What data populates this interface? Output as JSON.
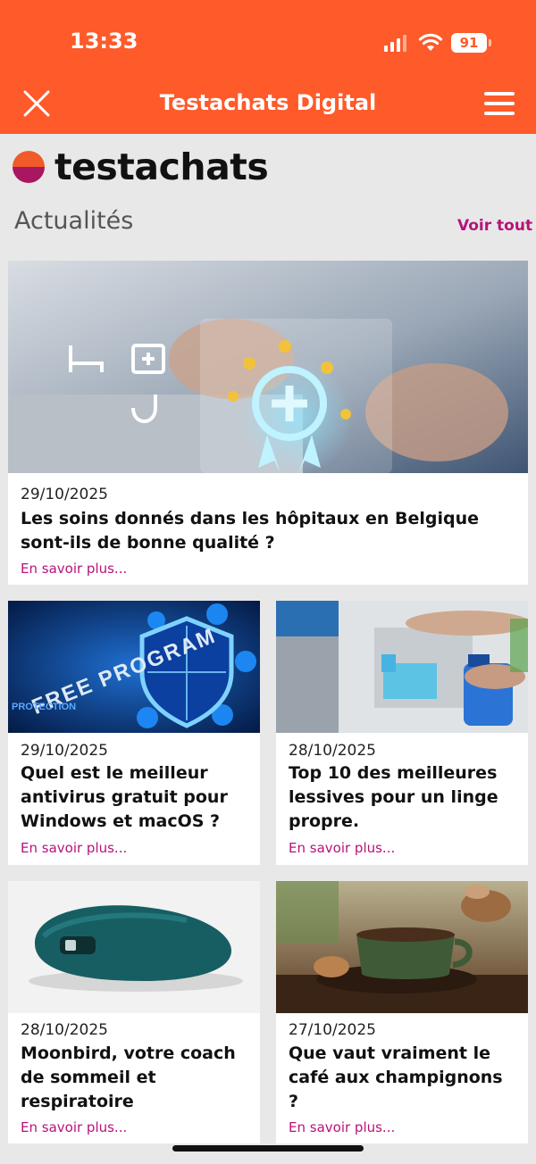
{
  "status_bar": {
    "time": "13:33",
    "battery": "91"
  },
  "nav": {
    "title": "Testachats Digital"
  },
  "brand": {
    "logo_text": "testachats"
  },
  "section": {
    "title": "Actualités",
    "see_all": "Voir tout"
  },
  "articles": [
    {
      "date": "29/10/2025",
      "title": "Les soins donnés dans les hôpitaux en Belgique sont-ils de bonne qualité ?",
      "more": "En savoir plus..."
    },
    {
      "date": "29/10/2025",
      "title": "Quel est le meilleur antivirus gratuit pour Windows et macOS ?",
      "more": "En savoir plus...",
      "image_text": "FREE PROGRAM",
      "image_subtext": "PROTECTION"
    },
    {
      "date": "28/10/2025",
      "title": "Top 10 des meilleures lessives pour un linge propre.",
      "more": "En savoir plus..."
    },
    {
      "date": "28/10/2025",
      "title": "Moonbird, votre coach de sommeil et respiratoire",
      "more": "En savoir plus..."
    },
    {
      "date": "27/10/2025",
      "title": "Que vaut vraiment le café aux champignons ?",
      "more": "En savoir plus..."
    }
  ],
  "colors": {
    "header": "#fe5a2a",
    "accent": "#b8127a",
    "background": "#e8e8e8"
  }
}
